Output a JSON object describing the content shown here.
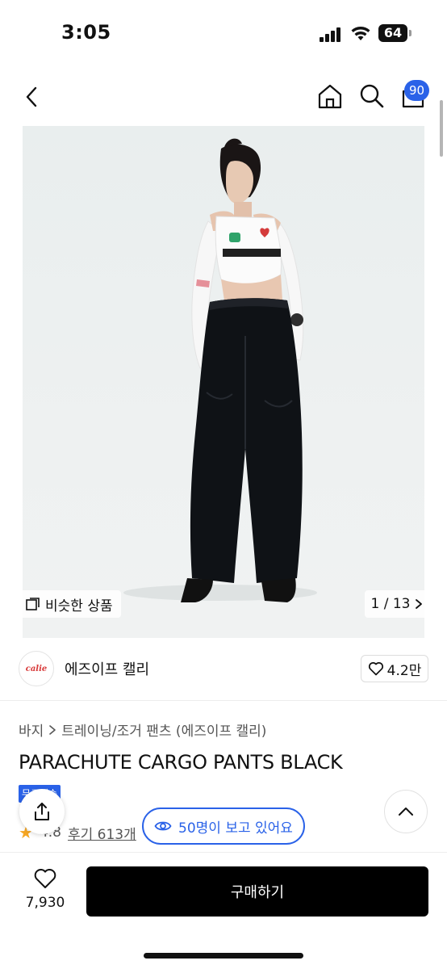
{
  "status_bar": {
    "time": "3:05",
    "battery": "64"
  },
  "header": {
    "cart_count": "90"
  },
  "gallery": {
    "similar_label": "비슷한 상품",
    "page_indicator": "1 / 13"
  },
  "store": {
    "logo_text": "calie",
    "name": "에즈이프 캘리",
    "likes": "4.2만"
  },
  "product": {
    "breadcrumb": [
      "바지",
      "트레이닝/조거 팬츠 (에즈이프 캘리)"
    ],
    "title": "PARACHUTE CARGO PANTS BLACK",
    "badge": "무료배송",
    "rating": "4.8",
    "reviews": "후기 613개",
    "viewers": "50명이 보고 있어요"
  },
  "bottom_bar": {
    "wish_count": "7,930",
    "buy_label": "구매하기"
  },
  "colors": {
    "accent": "#2a62e8",
    "buy_button": "#000000",
    "star": "#f5a623"
  },
  "icons": [
    "back-icon",
    "home-icon",
    "search-icon",
    "cart-icon",
    "gallery-icon",
    "chevron-right-icon",
    "heart-icon",
    "share-icon",
    "eye-icon",
    "chevron-up-icon",
    "star-icon"
  ]
}
